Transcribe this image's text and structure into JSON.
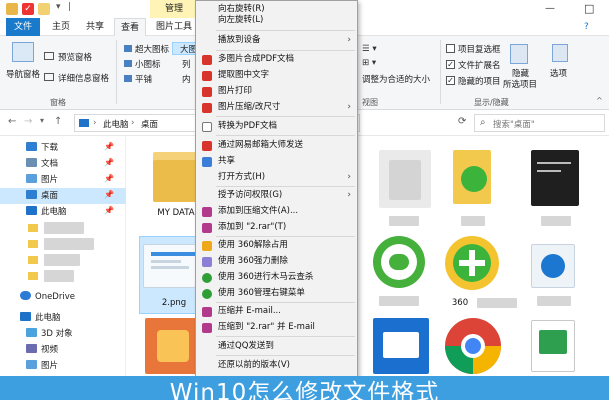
{
  "window": {
    "manage_tab": "管理"
  },
  "tabs": {
    "file": "文件",
    "home": "主页",
    "share": "共享",
    "view": "查看",
    "picture_tools": "图片工具"
  },
  "ribbon": {
    "nav_pane": "导航窗格",
    "preview_pane": "预览窗格",
    "details_pane": "详细信息窗格",
    "pane_group": "窗格",
    "xl_icons": "超大图标",
    "large_icons": "大图",
    "small_icons": "小图标",
    "list": "列",
    "tiles": "平铺",
    "content": "内",
    "size_all_cols": "调整为合适的大小",
    "view_group": "视图",
    "item_checkbox": "项目复选框",
    "ext": "文件扩展名",
    "hidden_items": "隐藏的项目",
    "hide_selected_1": "隐藏",
    "hide_selected_2": "所选项目",
    "showhide_group": "显示/隐藏",
    "options": "选项"
  },
  "address": {
    "path_1": "此电脑",
    "path_2": "桌面",
    "search_placeholder": "搜索\"桌面\""
  },
  "nav": {
    "items": [
      {
        "label": "下载",
        "pin": "📌"
      },
      {
        "label": "文档",
        "pin": "📌"
      },
      {
        "label": "图片",
        "pin": "📌"
      },
      {
        "label": "桌面",
        "pin": "📌"
      },
      {
        "label": "此电脑",
        "pin": "📌"
      },
      {
        "label": "OneDrive"
      },
      {
        "label": "此电脑"
      },
      {
        "label": "3D 对象"
      },
      {
        "label": "视频"
      },
      {
        "label": "图片"
      }
    ]
  },
  "files": {
    "mydata": "MY DATA",
    "png": "2.png",
    "n360": "360"
  },
  "menu": {
    "items": [
      {
        "label": "向右旋转(R)"
      },
      {
        "label": "向左旋转(L)"
      },
      {
        "label": "播放到设备",
        "arrow": "›"
      },
      {
        "label": "多图片合成PDF文档",
        "icon": "#d9342b"
      },
      {
        "label": "提取图中文字",
        "icon": "#d9342b"
      },
      {
        "label": "图片打印",
        "icon": "#d9342b"
      },
      {
        "label": "图片压缩/改尺寸",
        "icon": "#d9342b",
        "arrow": "›"
      },
      {
        "label": "转换为PDF文档",
        "icon": "#ffffff"
      },
      {
        "label": "通过网易邮箱大师发送",
        "icon": "#d9342b"
      },
      {
        "label": "共享",
        "icon": "#3b7dd8"
      },
      {
        "label": "打开方式(H)",
        "arrow": "›"
      },
      {
        "label": "授予访问权限(G)",
        "arrow": "›"
      },
      {
        "label": "添加到压缩文件(A)...",
        "icon": "#b23a8d"
      },
      {
        "label": "添加到 \"2.rar\"(T)",
        "icon": "#b23a8d"
      },
      {
        "label": "使用 360解除占用",
        "icon": "#f0a81b"
      },
      {
        "label": "使用 360强力删除",
        "icon": "#8b7fd6"
      },
      {
        "label": "使用 360进行木马云查杀",
        "icon": "#2f9e37"
      },
      {
        "label": "使用 360管理右键菜单",
        "icon": "#2f9e37"
      },
      {
        "label": "压缩并 E-mail...",
        "icon": "#b23a8d"
      },
      {
        "label": "压缩到 \"2.rar\" 并 E-mail",
        "icon": "#b23a8d"
      },
      {
        "label": "通过QQ发送到"
      },
      {
        "label": "还原以前的版本(V)"
      }
    ]
  },
  "banner": {
    "text": "Win10怎么修改文件格式"
  }
}
